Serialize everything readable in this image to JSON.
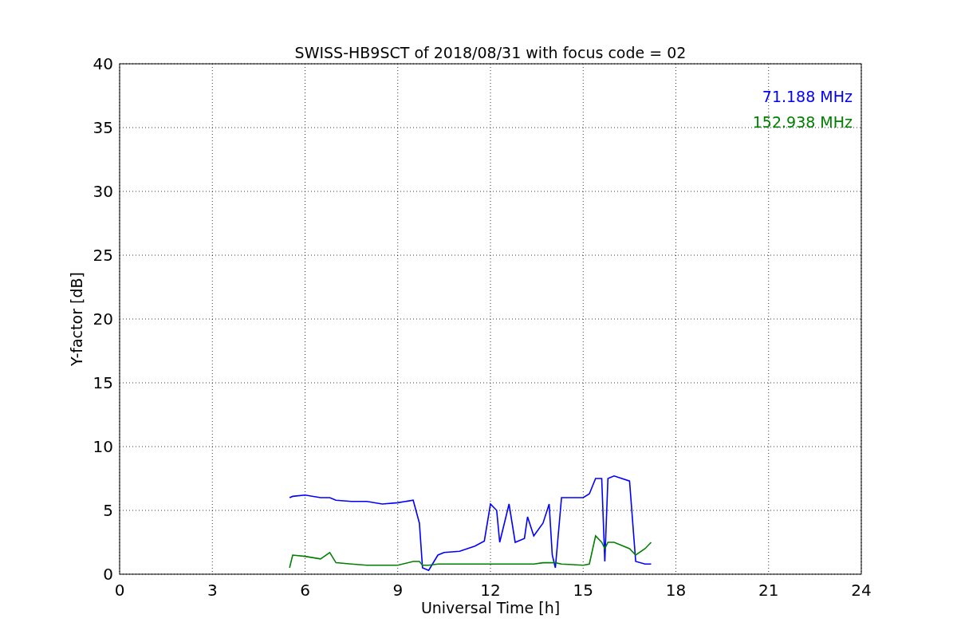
{
  "figure": {
    "chart_data": {
      "type": "line",
      "title": "SWISS-HB9SCT of 2018/08/31 with focus code = 02",
      "xlabel": "Universal Time [h]",
      "ylabel": "Y-factor [dB]",
      "x": [
        5.5,
        5.6,
        6,
        6.5,
        6.8,
        7,
        7.5,
        8,
        8.5,
        9,
        9.5,
        9.7,
        9.8,
        10,
        10.3,
        10.5,
        11,
        11.5,
        11.8,
        12,
        12.2,
        12.3,
        12.6,
        12.8,
        13.1,
        13.2,
        13.4,
        13.7,
        13.9,
        14,
        14.1,
        14.3,
        15,
        15.2,
        15.4,
        15.6,
        15.7,
        15.8,
        16,
        16.5,
        16.7,
        17,
        17.2
      ],
      "series": [
        {
          "name": "71.188 MHz",
          "color": "#0000ff",
          "values": [
            6,
            6.1,
            6.2,
            6,
            6,
            5.8,
            5.7,
            5.7,
            5.5,
            5.6,
            5.8,
            4,
            0.5,
            0.3,
            1.5,
            1.7,
            1.8,
            2.2,
            2.6,
            5.5,
            5,
            2.5,
            5.5,
            2.5,
            2.8,
            4.5,
            3,
            4,
            5.5,
            1.5,
            0.5,
            6,
            6,
            6.3,
            7.5,
            7.5,
            1,
            7.5,
            7.7,
            7.3,
            1,
            0.8,
            0.8
          ]
        },
        {
          "name": "152.938 MHz",
          "color": "#008000",
          "values": [
            0.5,
            1.5,
            1.4,
            1.2,
            1.7,
            0.9,
            0.8,
            0.7,
            0.7,
            0.7,
            1,
            1,
            0.7,
            0.7,
            0.8,
            0.8,
            0.8,
            0.8,
            0.8,
            0.8,
            0.8,
            0.8,
            0.8,
            0.8,
            0.8,
            0.8,
            0.8,
            0.9,
            0.9,
            0.9,
            0.9,
            0.8,
            0.7,
            0.8,
            3,
            2.5,
            2,
            2.5,
            2.5,
            2,
            1.5,
            2,
            2.5
          ]
        }
      ],
      "grid": true,
      "xlim": [
        0,
        24
      ],
      "ylim": [
        0,
        40
      ],
      "xticks": [
        0,
        3,
        6,
        9,
        12,
        15,
        18,
        21,
        24
      ],
      "yticks": [
        0,
        5,
        10,
        15,
        20,
        25,
        30,
        35,
        40
      ]
    }
  }
}
